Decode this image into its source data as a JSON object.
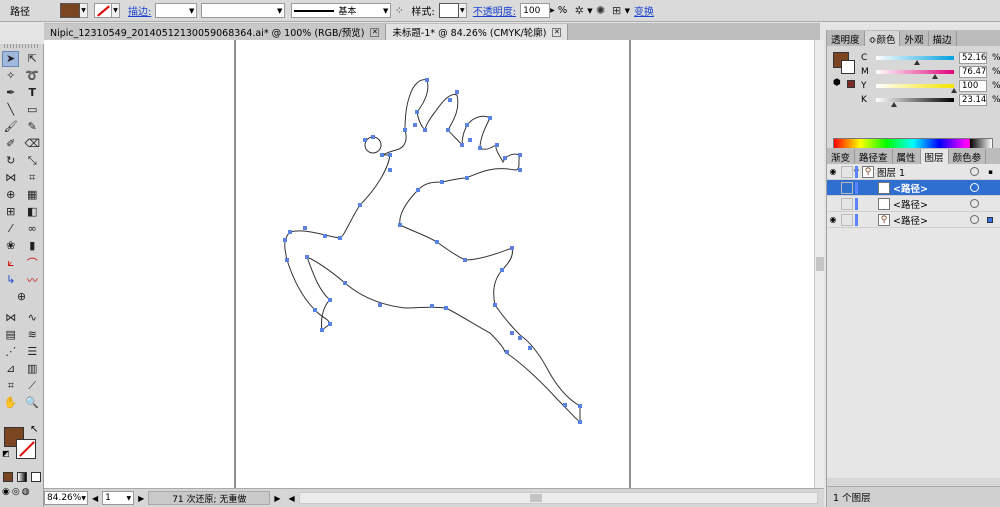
{
  "control_bar": {
    "object_type": "路径",
    "stroke_label": "描边:",
    "brush_label": "基本",
    "style_label": "样式:",
    "opacity_label": "不透明度:",
    "opacity_value": "100",
    "percent": "%",
    "transform_label": "变换"
  },
  "colors": {
    "fill": "#7a4520",
    "stroke": "none",
    "anchor": "#5b82e0",
    "layer_color": "#5a83ff",
    "selection_blue": "#2f6fd0"
  },
  "tabs": [
    {
      "label": "Nipic_12310549_20140512130059068364.ai* @ 100% (RGB/预览)",
      "active": false
    },
    {
      "label": "未标题-1* @ 84.26% (CMYK/轮廓)",
      "active": true
    }
  ],
  "color_panel": {
    "tabs": [
      "透明度",
      "≎颜色",
      "外观",
      "描边"
    ],
    "channels": [
      {
        "name": "C",
        "value": "52.16",
        "level": 0.52,
        "gradient": "linear-gradient(90deg,#fff,#00a0e0)"
      },
      {
        "name": "M",
        "value": "76.47",
        "level": 0.76,
        "gradient": "linear-gradient(90deg,#fff,#e0007a)"
      },
      {
        "name": "Y",
        "value": "100",
        "level": 1.0,
        "gradient": "linear-gradient(90deg,#fff,#f5e400)"
      },
      {
        "name": "K",
        "value": "23.14",
        "level": 0.23,
        "gradient": "linear-gradient(90deg,#fff,#000)"
      }
    ]
  },
  "layers_panel": {
    "tabs": [
      "渐变",
      "路径查",
      "属性",
      "图层",
      "颜色参"
    ],
    "rows": [
      {
        "label": "图层 1",
        "indent": 0,
        "selected": false,
        "eye": true,
        "thumb": "layer"
      },
      {
        "label": "<路径>",
        "indent": 1,
        "selected": true,
        "eye": false,
        "thumb": "empty"
      },
      {
        "label": "<路径>",
        "indent": 1,
        "selected": false,
        "eye": false,
        "thumb": "empty"
      },
      {
        "label": "<路径>",
        "indent": 1,
        "selected": false,
        "eye": true,
        "thumb": "deer"
      }
    ],
    "footer": "1 个图层"
  },
  "status_bar": {
    "zoom": "84.26%",
    "page": "1",
    "info": "71 次还原; 无重做"
  }
}
